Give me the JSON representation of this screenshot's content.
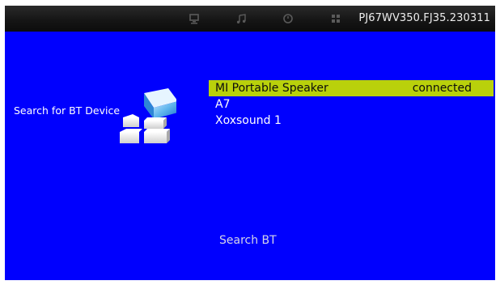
{
  "header": {
    "icons": [
      "monitor-icon",
      "music-note-icon",
      "clock-icon",
      "apps-grid-icon"
    ],
    "version": "PJ67WV350.FJ35.230311"
  },
  "side": {
    "label": "Search for BT Device",
    "icon": "bluetooth-device-search-icon"
  },
  "devices": [
    {
      "name": "MI Portable Speaker",
      "status": "connected",
      "selected": true
    },
    {
      "name": "A7",
      "status": ""
    },
    {
      "name": "Xoxsound 1",
      "status": ""
    }
  ],
  "search_button": "Search BT",
  "colors": {
    "background": "#0000fe",
    "selection": "#b9d10b",
    "topbar": "#161616"
  }
}
